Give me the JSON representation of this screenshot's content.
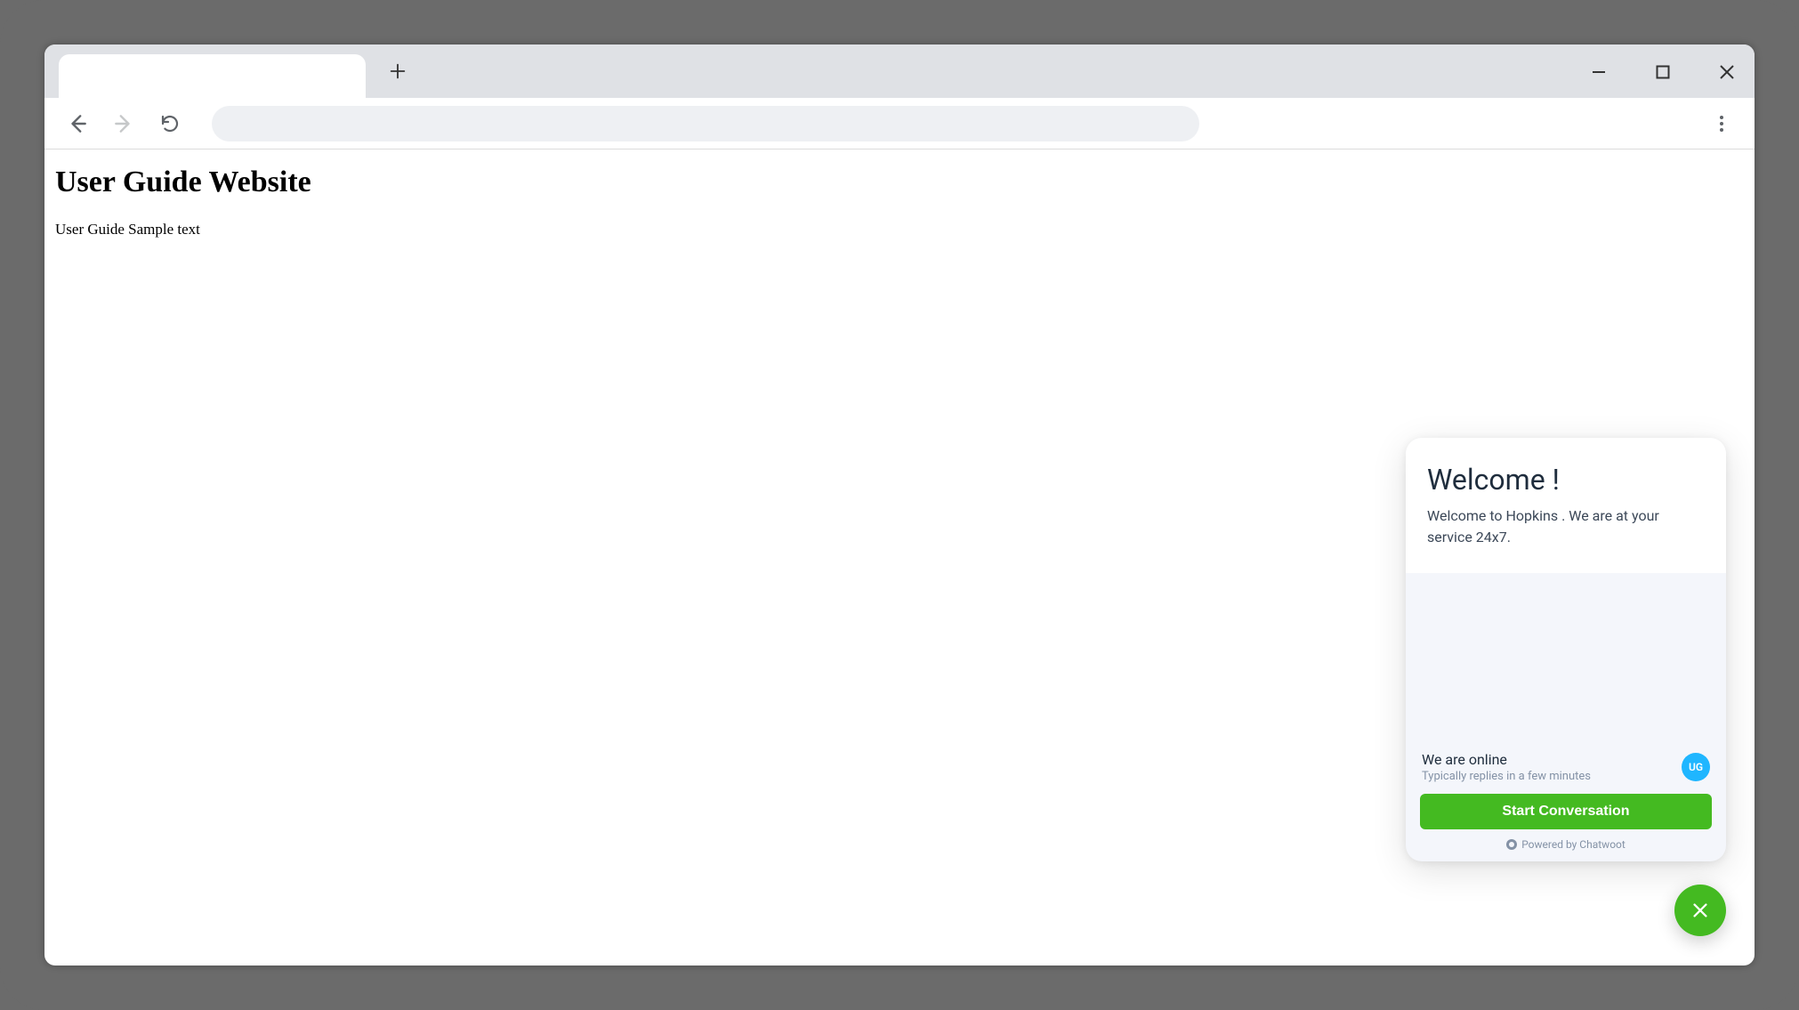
{
  "page": {
    "title": "User Guide Website",
    "body_text": "User Guide Sample text"
  },
  "chat": {
    "welcome_title": "Welcome !",
    "welcome_text": "Welcome to Hopkins . We are at your service 24x7.",
    "status_line": "We are online",
    "status_sub": "Typically replies in a few minutes",
    "avatar_initials": "UG",
    "start_button": "Start Conversation",
    "powered_by": "Powered by Chatwoot"
  },
  "colors": {
    "accent_green": "#44ba21",
    "avatar_blue": "#1fb6ff"
  }
}
